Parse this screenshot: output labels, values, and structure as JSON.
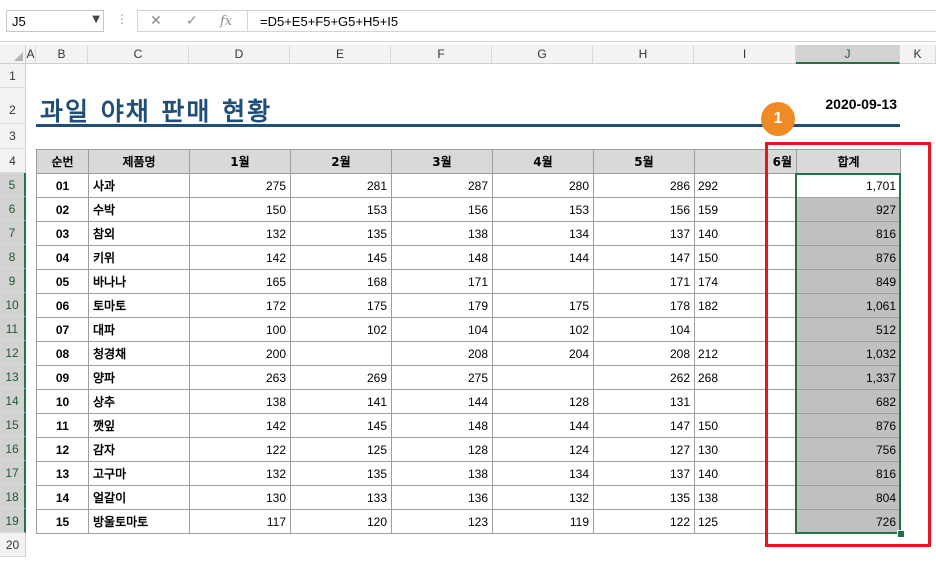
{
  "formula_bar": {
    "name_box": "J5",
    "cancel_icon": "✕",
    "enter_icon": "✓",
    "function_icon": "fx",
    "formula": "=D5+E5+F5+G5+H5+I5"
  },
  "columns": [
    "A",
    "B",
    "C",
    "D",
    "E",
    "F",
    "G",
    "H",
    "I",
    "J",
    "K"
  ],
  "rows": [
    "1",
    "2",
    "3",
    "4",
    "5",
    "6",
    "7",
    "8",
    "9",
    "10",
    "11",
    "12",
    "13",
    "14",
    "15",
    "16",
    "17",
    "18",
    "19",
    "20"
  ],
  "selected_column": "J",
  "title": "과일 야채 판매 현황",
  "date": "2020-09-13",
  "badge": "1",
  "table": {
    "headers": [
      "순번",
      "제품명",
      "1월",
      "2월",
      "3월",
      "4월",
      "5월",
      "6월",
      "합계"
    ],
    "rows": [
      [
        "01",
        "사과",
        "275",
        "281",
        "287",
        "280",
        "286",
        "292",
        "1,701"
      ],
      [
        "02",
        "수박",
        "150",
        "153",
        "156",
        "153",
        "156",
        "159",
        "927"
      ],
      [
        "03",
        "참외",
        "132",
        "135",
        "138",
        "134",
        "137",
        "140",
        "816"
      ],
      [
        "04",
        "키위",
        "142",
        "145",
        "148",
        "144",
        "147",
        "150",
        "876"
      ],
      [
        "05",
        "바나나",
        "165",
        "168",
        "171",
        "",
        "171",
        "174",
        "849"
      ],
      [
        "06",
        "토마토",
        "172",
        "175",
        "179",
        "175",
        "178",
        "182",
        "1,061"
      ],
      [
        "07",
        "대파",
        "100",
        "102",
        "104",
        "102",
        "104",
        "",
        "512"
      ],
      [
        "08",
        "청경채",
        "200",
        "",
        "208",
        "204",
        "208",
        "212",
        "1,032"
      ],
      [
        "09",
        "양파",
        "263",
        "269",
        "275",
        "",
        "262",
        "268",
        "1,337"
      ],
      [
        "10",
        "상추",
        "138",
        "141",
        "144",
        "128",
        "131",
        "",
        "682"
      ],
      [
        "11",
        "깻잎",
        "142",
        "145",
        "148",
        "144",
        "147",
        "150",
        "876"
      ],
      [
        "12",
        "감자",
        "122",
        "125",
        "128",
        "124",
        "127",
        "130",
        "756"
      ],
      [
        "13",
        "고구마",
        "132",
        "135",
        "138",
        "134",
        "137",
        "140",
        "816"
      ],
      [
        "14",
        "얼갈이",
        "130",
        "133",
        "136",
        "132",
        "135",
        "138",
        "804"
      ],
      [
        "15",
        "방울토마토",
        "117",
        "120",
        "123",
        "119",
        "122",
        "125",
        "726"
      ]
    ]
  }
}
